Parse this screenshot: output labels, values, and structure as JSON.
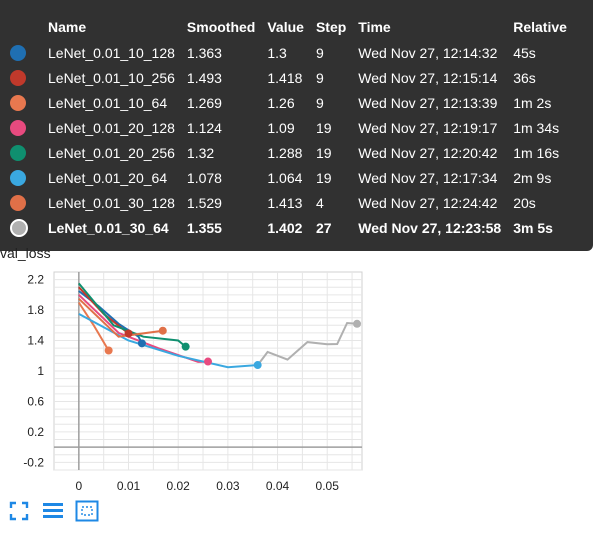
{
  "chart_data": {
    "type": "line",
    "title": "val_loss",
    "yticks": [
      "2.2",
      "1.8",
      "1.4",
      "1",
      "0.6",
      "0.2",
      "-0.2"
    ],
    "xticks": [
      "0",
      "0.01",
      "0.02",
      "0.03",
      "0.04",
      "0.05"
    ],
    "ylim": [
      -0.3,
      2.3
    ],
    "xlim": [
      -0.005,
      0.057
    ],
    "series": [
      {
        "name": "LeNet_0.01_10_128",
        "color": "#1f6fb2",
        "values": [
          [
            0,
            2.05
          ],
          [
            0.004,
            1.85
          ],
          [
            0.008,
            1.62
          ],
          [
            0.012,
            1.45
          ],
          [
            0.0127,
            1.363
          ]
        ]
      },
      {
        "name": "LeNet_0.01_10_256",
        "color": "#c0392b",
        "values": [
          [
            0,
            2.1
          ],
          [
            0.005,
            1.75
          ],
          [
            0.01,
            1.493
          ]
        ]
      },
      {
        "name": "LeNet_0.01_10_64",
        "color": "#e8784f",
        "values": [
          [
            0,
            1.9
          ],
          [
            0.003,
            1.6
          ],
          [
            0.006,
            1.269
          ]
        ]
      },
      {
        "name": "LeNet_0.01_20_128",
        "color": "#e84a7f",
        "values": [
          [
            0,
            2.0
          ],
          [
            0.008,
            1.5
          ],
          [
            0.016,
            1.3
          ],
          [
            0.024,
            1.12
          ],
          [
            0.026,
            1.124
          ]
        ]
      },
      {
        "name": "LeNet_0.01_20_256",
        "color": "#0f8f6f",
        "values": [
          [
            0,
            2.15
          ],
          [
            0.007,
            1.6
          ],
          [
            0.013,
            1.45
          ],
          [
            0.02,
            1.4
          ],
          [
            0.0215,
            1.32
          ]
        ]
      },
      {
        "name": "LeNet_0.01_20_64",
        "color": "#3aa8e0",
        "values": [
          [
            0,
            1.75
          ],
          [
            0.01,
            1.4
          ],
          [
            0.02,
            1.2
          ],
          [
            0.03,
            1.05
          ],
          [
            0.036,
            1.078
          ]
        ]
      },
      {
        "name": "LeNet_0.01_30_128",
        "color": "#e07048",
        "values": [
          [
            0,
            1.95
          ],
          [
            0.008,
            1.45
          ],
          [
            0.0169,
            1.529
          ]
        ]
      },
      {
        "name": "LeNet_0.01_30_64",
        "color": "#b0b0b0",
        "values": [
          [
            0.036,
            1.078
          ],
          [
            0.038,
            1.25
          ],
          [
            0.042,
            1.15
          ],
          [
            0.046,
            1.38
          ],
          [
            0.05,
            1.35
          ],
          [
            0.052,
            1.355
          ],
          [
            0.054,
            1.63
          ],
          [
            0.056,
            1.62
          ]
        ]
      }
    ],
    "grid": true
  },
  "tooltip": {
    "headers": {
      "name": "Name",
      "smoothed": "Smoothed",
      "value": "Value",
      "step": "Step",
      "time": "Time",
      "relative": "Relative"
    },
    "rows": [
      {
        "color": "#1f6fb2",
        "name": "LeNet_0.01_10_128",
        "smoothed": "1.363",
        "value": "1.3",
        "step": "9",
        "time": "Wed Nov 27, 12:14:32",
        "relative": "45s"
      },
      {
        "color": "#c0392b",
        "name": "LeNet_0.01_10_256",
        "smoothed": "1.493",
        "value": "1.418",
        "step": "9",
        "time": "Wed Nov 27, 12:15:14",
        "relative": "36s"
      },
      {
        "color": "#e8784f",
        "name": "LeNet_0.01_10_64",
        "smoothed": "1.269",
        "value": "1.26",
        "step": "9",
        "time": "Wed Nov 27, 12:13:39",
        "relative": "1m 2s"
      },
      {
        "color": "#e84a7f",
        "name": "LeNet_0.01_20_128",
        "smoothed": "1.124",
        "value": "1.09",
        "step": "19",
        "time": "Wed Nov 27, 12:19:17",
        "relative": "1m 34s"
      },
      {
        "color": "#0f8f6f",
        "name": "LeNet_0.01_20_256",
        "smoothed": "1.32",
        "value": "1.288",
        "step": "19",
        "time": "Wed Nov 27, 12:20:42",
        "relative": "1m 16s"
      },
      {
        "color": "#3aa8e0",
        "name": "LeNet_0.01_20_64",
        "smoothed": "1.078",
        "value": "1.064",
        "step": "19",
        "time": "Wed Nov 27, 12:17:34",
        "relative": "2m 9s"
      },
      {
        "color": "#e07048",
        "name": "LeNet_0.01_30_128",
        "smoothed": "1.529",
        "value": "1.413",
        "step": "4",
        "time": "Wed Nov 27, 12:24:42",
        "relative": "20s"
      },
      {
        "color": "#b0b0b0",
        "name": "LeNet_0.01_30_64",
        "smoothed": "1.355",
        "value": "1.402",
        "step": "27",
        "time": "Wed Nov 27, 12:23:58",
        "relative": "3m 5s",
        "selected": true
      }
    ]
  },
  "toolbar": {
    "icons": [
      "fullscreen-icon",
      "legend-toggle-icon",
      "fit-domain-icon"
    ]
  }
}
